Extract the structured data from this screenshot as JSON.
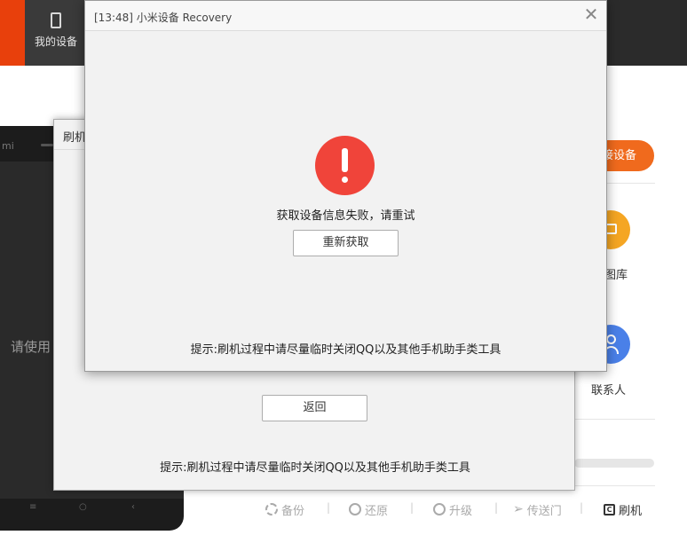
{
  "app": {
    "nav": {
      "my_device_label": "我的设备"
    },
    "connect_button": "接设备",
    "features": {
      "gallery_label": "图库",
      "contacts_label": "联系人"
    },
    "phone": {
      "brand": "mi",
      "hint": "请使用"
    },
    "toolbar": {
      "backup": "备份",
      "restore": "还原",
      "upgrade": "升级",
      "transfer": "传送门",
      "flash": "刷机",
      "separator": "|"
    }
  },
  "flash_dialog": {
    "title": "刷机",
    "back_button": "返回",
    "tip": "提示:刷机过程中请尽量临时关闭QQ以及其他手机助手类工具"
  },
  "recovery_dialog": {
    "title": "[13:48] 小米设备 Recovery",
    "close_symbol": "✕",
    "message": "获取设备信息失败，请重试",
    "retry_button": "重新获取",
    "tip": "提示:刷机过程中请尽量临时关闭QQ以及其他手机助手类工具"
  },
  "colors": {
    "brand_orange": "#e8400c",
    "connect_orange": "#f06a1d",
    "error_red": "#f0443a",
    "gallery_yellow": "#f5a623",
    "contacts_blue": "#4a80e8"
  }
}
